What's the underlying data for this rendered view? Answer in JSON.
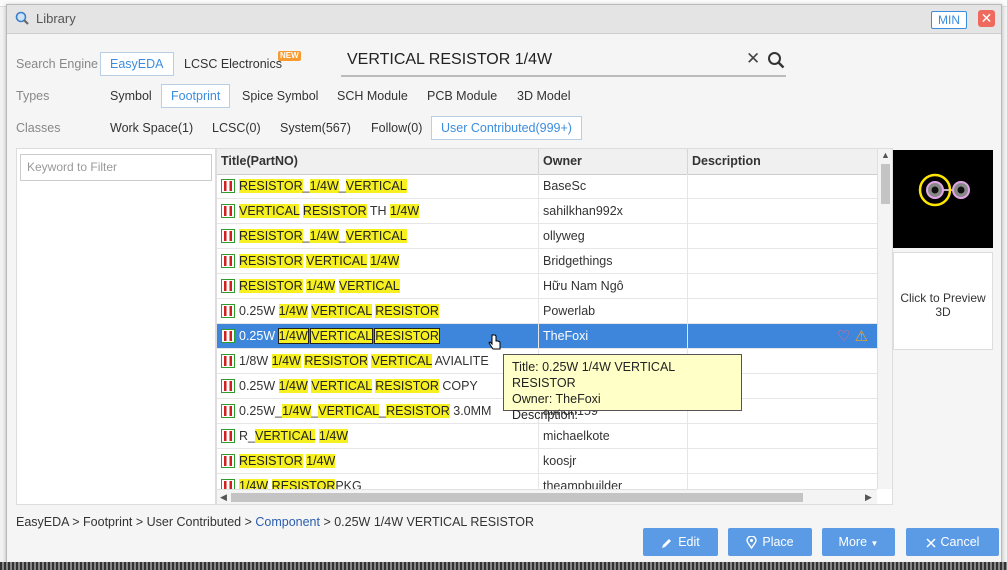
{
  "window": {
    "title": "Library",
    "min_label": "MIN",
    "close_label": "✕"
  },
  "search_engine": {
    "label": "Search Engine",
    "options": [
      "EasyEDA",
      "LCSC Electronics"
    ],
    "new_badge": "NEW"
  },
  "search": {
    "value": "VERTICAL RESISTOR 1/4W",
    "clear": "✕"
  },
  "types": {
    "label": "Types",
    "options": [
      "Symbol",
      "Footprint",
      "Spice Symbol",
      "SCH Module",
      "PCB Module",
      "3D Model"
    ]
  },
  "classes": {
    "label": "Classes",
    "options": [
      "Work Space(1)",
      "LCSC(0)",
      "System(567)",
      "Follow(0)",
      "User Contributed(999+)"
    ]
  },
  "filter": {
    "placeholder": "Keyword to Filter"
  },
  "table": {
    "headers": [
      "Title(PartNO)",
      "Owner",
      "Description"
    ],
    "rows": [
      {
        "title": "RESISTOR_1/4W_VERTICAL",
        "owner": "BaseSc",
        "description": ""
      },
      {
        "title": "VERTICAL RESISTOR TH 1/4W",
        "owner": "sahilkhan992x",
        "description": ""
      },
      {
        "title": "RESISTOR_1/4W_VERTICAL",
        "owner": "ollyweg",
        "description": ""
      },
      {
        "title": "RESISTOR VERTICAL 1/4W",
        "owner": "Bridgethings",
        "description": ""
      },
      {
        "title": "RESISTOR 1/4W VERTICAL",
        "owner": "Hữu Nam Ngô",
        "description": ""
      },
      {
        "title": "0.25W 1/4W VERTICAL RESISTOR",
        "owner": "Powerlab",
        "description": ""
      },
      {
        "title": "0.25W 1/4W VERTICAL RESISTOR",
        "owner": "TheFoxi",
        "description": ""
      },
      {
        "title": "1/8W 1/4W RESISTOR VERTICAL AVIALITE",
        "owner": "",
        "description": ""
      },
      {
        "title": "0.25W 1/4W VERTICAL RESISTOR COPY",
        "owner": "",
        "description": ""
      },
      {
        "title": "0.25W_1/4W_VERTICAL_RESISTOR 3.0MM",
        "owner": "aimon159",
        "description": ""
      },
      {
        "title": "R_VERTICAL 1/4W",
        "owner": "michaelkote",
        "description": ""
      },
      {
        "title": "RESISTOR 1/4W",
        "owner": "koosjr",
        "description": ""
      },
      {
        "title": "1/4W RESISTORPKG",
        "owner": "theampbuilder",
        "description": ""
      }
    ],
    "selected_index": 6,
    "highlight_terms": [
      "VERTICAL",
      "RESISTOR",
      "1/4W"
    ]
  },
  "tooltip": {
    "title": "Title: 0.25W 1/4W VERTICAL RESISTOR",
    "owner": "Owner: TheFoxi",
    "description": "Description:"
  },
  "preview": {
    "click_3d": "Click to Preview 3D"
  },
  "breadcrumb": {
    "prefix": "EasyEDA > Footprint > User Contributed > ",
    "link": "Component",
    "suffix": " > 0.25W 1/4W VERTICAL RESISTOR"
  },
  "buttons": {
    "edit": "Edit",
    "place": "Place",
    "more": "More",
    "cancel": "Cancel"
  },
  "colors": {
    "accent": "#3c8dde",
    "button": "#5b9be6",
    "selected_row": "#3d86dc",
    "highlight": "#f6f020",
    "close": "#ef6a5e"
  }
}
